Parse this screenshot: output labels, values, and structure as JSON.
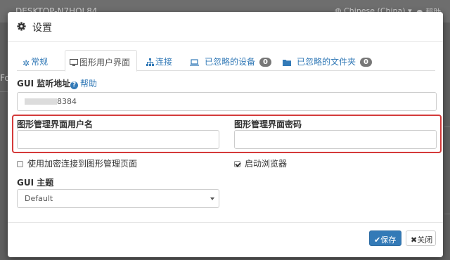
{
  "background": {
    "hostname": "DESKTOP-N7HOL84",
    "language": "Chinese (China)",
    "language_caret": "▾",
    "help": "帮助",
    "left_fragment": "Fo"
  },
  "modal": {
    "title": "设置",
    "tabs": [
      {
        "label": "常规",
        "icon": "gear-icon"
      },
      {
        "label": "图形用户界面",
        "icon": "monitor-icon"
      },
      {
        "label": "连接",
        "icon": "sitemap-icon"
      },
      {
        "label": "已忽略的设备",
        "icon": "laptop-icon",
        "badge": "0"
      },
      {
        "label": "已忽略的文件夹",
        "icon": "folder-icon",
        "badge": "0"
      }
    ],
    "active_tab": "图形用户界面",
    "gui_listen": {
      "label": "GUI 监听地址",
      "help": "帮助",
      "value_suffix": "8384"
    },
    "username": {
      "label": "图形管理界面用户名",
      "value": ""
    },
    "password": {
      "label": "图形管理界面密码",
      "value": ""
    },
    "https": {
      "label": "使用加密连接到图形管理页面",
      "checked": false
    },
    "browser": {
      "label": "启动浏览器",
      "checked": true
    },
    "theme": {
      "label": "GUI 主题",
      "value": "Default"
    },
    "buttons": {
      "save": "保存",
      "close": "关闭"
    }
  },
  "colors": {
    "primary": "#337ab7",
    "highlight": "#d43a3a",
    "badge": "#777777"
  }
}
